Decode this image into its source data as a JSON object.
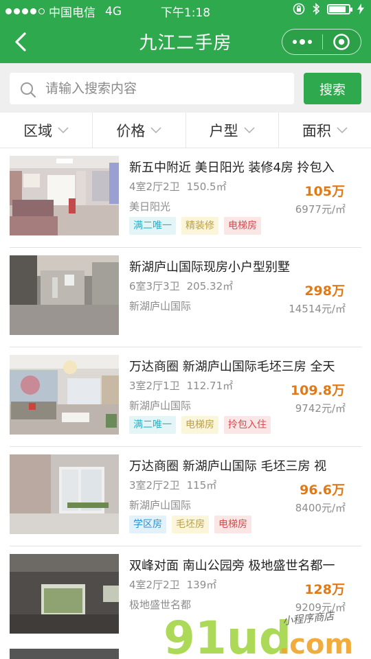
{
  "status_bar": {
    "carrier": "中国电信",
    "network": "4G",
    "time": "下午1:18",
    "battery_level": 0.85
  },
  "nav": {
    "title": "九江二手房"
  },
  "search": {
    "placeholder": "请输入搜索内容",
    "button_label": "搜索"
  },
  "filters": [
    "区域",
    "价格",
    "户型",
    "面积"
  ],
  "listings": [
    {
      "title": "新五中附近 美日阳光 装修4房 拎包入",
      "layout": "4室2厅2卫",
      "area": "150.5㎡",
      "estate": "美日阳光",
      "price": "105万",
      "unit_price": "6977元/㎡",
      "tags": [
        {
          "text": "满二唯一",
          "color": "#27b2c7"
        },
        {
          "text": "精装修",
          "color": "#b9a04c"
        },
        {
          "text": "电梯房",
          "color": "#d24d50"
        }
      ]
    },
    {
      "title": "新湖庐山国际现房小户型别墅",
      "layout": "6室3厅3卫",
      "area": "205.32㎡",
      "estate": "新湖庐山国际",
      "price": "298万",
      "unit_price": "14514元/㎡",
      "tags": []
    },
    {
      "title": "万达商圈 新湖庐山国际毛坯三房 全天",
      "layout": "3室2厅1卫",
      "area": "112.71㎡",
      "estate": "新湖庐山国际",
      "price": "109.8万",
      "unit_price": "9742元/㎡",
      "tags": [
        {
          "text": "满二唯一",
          "color": "#27b2c7"
        },
        {
          "text": "电梯房",
          "color": "#b9a04c"
        },
        {
          "text": "拎包入住",
          "color": "#d24d50"
        }
      ]
    },
    {
      "title": "万达商圈 新湖庐山国际 毛坯三房 视",
      "layout": "3室2厅2卫",
      "area": "115㎡",
      "estate": "新湖庐山国际",
      "price": "96.6万",
      "unit_price": "8400元/㎡",
      "tags": [
        {
          "text": "学区房",
          "color": "#2a93d5"
        },
        {
          "text": "毛坯房",
          "color": "#b9a04c"
        },
        {
          "text": "电梯房",
          "color": "#d24d50"
        }
      ]
    },
    {
      "title": "双峰对面 南山公园旁 极地盛世名都一",
      "layout": "4室2厅2卫",
      "area": "139㎡",
      "estate": "极地盛世名都",
      "price": "128万",
      "unit_price": "9209元/㎡",
      "tags": []
    }
  ],
  "watermark": {
    "logo_text": "91ud.com",
    "handwriting": "小程序商店"
  }
}
